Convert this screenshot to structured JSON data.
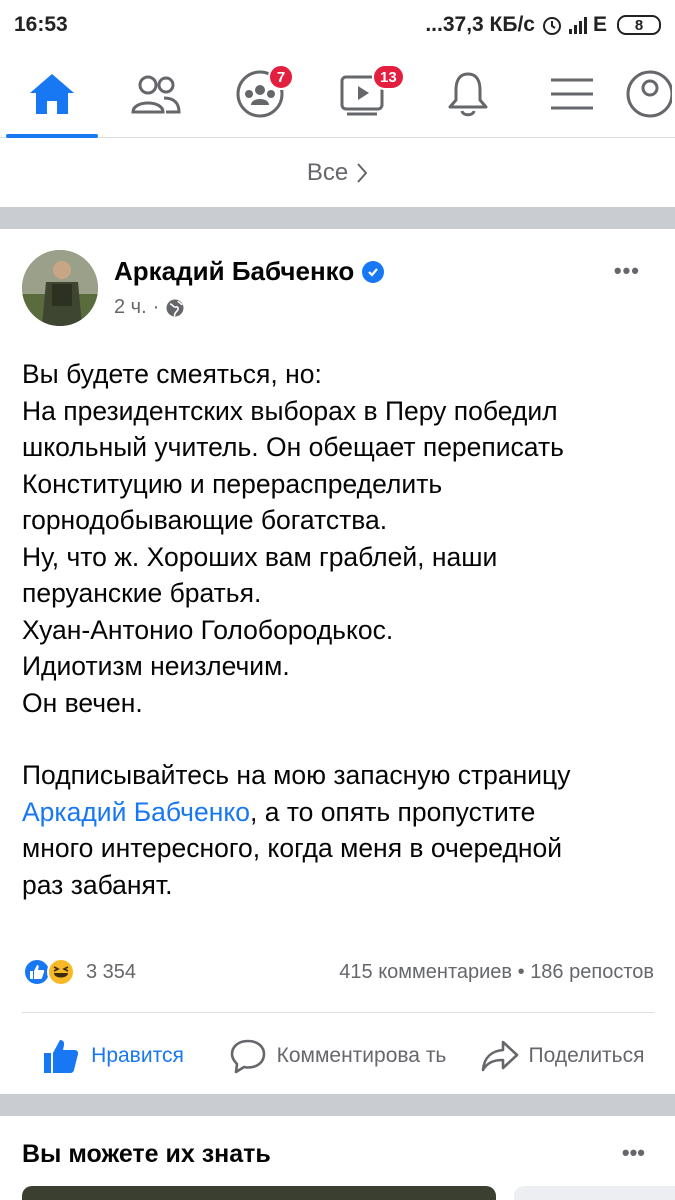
{
  "status_bar": {
    "time": "16:53",
    "network_speed": "...37,3 КБ/с",
    "network_type": "E",
    "battery": "8"
  },
  "nav": {
    "items": [
      {
        "icon": "home-icon",
        "active": true
      },
      {
        "icon": "friends-icon"
      },
      {
        "icon": "groups-icon",
        "badge": "7"
      },
      {
        "icon": "watch-icon",
        "badge": "13"
      },
      {
        "icon": "notifications-icon"
      },
      {
        "icon": "menu-icon"
      },
      {
        "icon": "profile-icon"
      }
    ],
    "accent": "#1877f2"
  },
  "filter": {
    "label": "Все"
  },
  "post": {
    "author": "Аркадий Бабченко",
    "time": "2 ч.",
    "audience_icon": "globe-icon",
    "lines": [
      "Вы будете смеяться, но:",
      "На президентских выборах в Перу победил",
      "школьный учитель. Он обещает переписать",
      "Конституцию и перераспределить",
      "горнодобывающие богатства.",
      "Ну, что ж. Хороших вам граблей, наши",
      "перуанские братья.",
      "Хуан-Антонио Голобородькос.",
      "Идиотизм неизлечим.",
      "Он вечен."
    ],
    "subscribe_prefix": "Подписывайтесь на мою запасную страницу",
    "subscribe_link": "Аркадий Бабченко",
    "subscribe_line2_rest": ", а то опять пропустите",
    "subscribe_line3": "много интересного, когда меня в очередной",
    "subscribe_line4": "раз забанят.",
    "reactions_count": "3 354",
    "comments": "415 комментариев",
    "shares": "186 репостов",
    "like_label": "Нравится",
    "comment_label": "Комментирова ть",
    "share_label": "Поделиться"
  },
  "pymk": {
    "title": "Вы можете их знать"
  }
}
